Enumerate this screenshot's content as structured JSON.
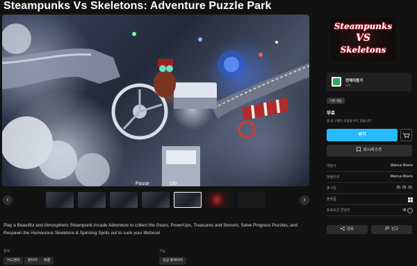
{
  "page": {
    "title": "Steampunks Vs Skeletons: Adventure Puzzle Park",
    "main_media_alt": "",
    "media_hud": {
      "left_text": "Pause",
      "right_text": "100"
    }
  },
  "gallery": {
    "prev_icon": "chevron-left-icon",
    "next_icon": "chevron-right-icon",
    "prev_glyph": "‹",
    "next_glyph": "›",
    "thumbnails": [
      {
        "kind": "screenshot",
        "active": false
      },
      {
        "kind": "screenshot",
        "active": false
      },
      {
        "kind": "screenshot",
        "active": false
      },
      {
        "kind": "screenshot",
        "active": false
      },
      {
        "kind": "screenshot",
        "active": true
      },
      {
        "kind": "logo",
        "active": false
      },
      {
        "kind": "dark",
        "active": false
      }
    ]
  },
  "description": "Play a Beautiful and Atmospheric Steampunk Arcade Adventure to collect the Gears, PowerUps, Treasures and Secrets, Solve Progress Puzzles, and Respawn the Humourous Skeletons & Spinning Sprits out to suck your lifeforce!",
  "genres": {
    "label": "장르",
    "tags": [
      "어드벤처",
      "판타지",
      "퍼즐"
    ]
  },
  "features": {
    "label": "기능",
    "tags": [
      "싱글 플레이어"
    ]
  },
  "sidebar": {
    "logo_line1": "Steampunks",
    "logo_line2": "VS",
    "logo_line3": "Skeletons",
    "rating": {
      "title": "전체이용가",
      "subtitle": "모두",
      "icon": "rating-all-ages-icon",
      "color": "#34a85a"
    },
    "base_game_badge": "기본 게임",
    "price": "무료",
    "purchase_note": "앱 내 구매가 포함될 수도 있습니다",
    "get_button": "받기",
    "cart_icon": "cart-icon",
    "wishlist_button": "위시리스트",
    "wishlist_icon": "bookmark-icon",
    "info": [
      {
        "label": "개발사",
        "value": "Marcus Rivers"
      },
      {
        "label": "퍼블리셔",
        "value": "Marcus Rivers"
      },
      {
        "label": "출시일",
        "value": "26. 05. 20."
      },
      {
        "label": "플랫폼",
        "value": "",
        "icon": "windows-icon"
      },
      {
        "label": "프로모션 콘텐츠",
        "value": "예"
      }
    ],
    "share_button": "공유",
    "share_icon": "share-icon",
    "report_button": "신고",
    "report_icon": "flag-icon"
  },
  "colors": {
    "accent": "#26bbff",
    "background": "#121212",
    "panel": "#202020"
  }
}
